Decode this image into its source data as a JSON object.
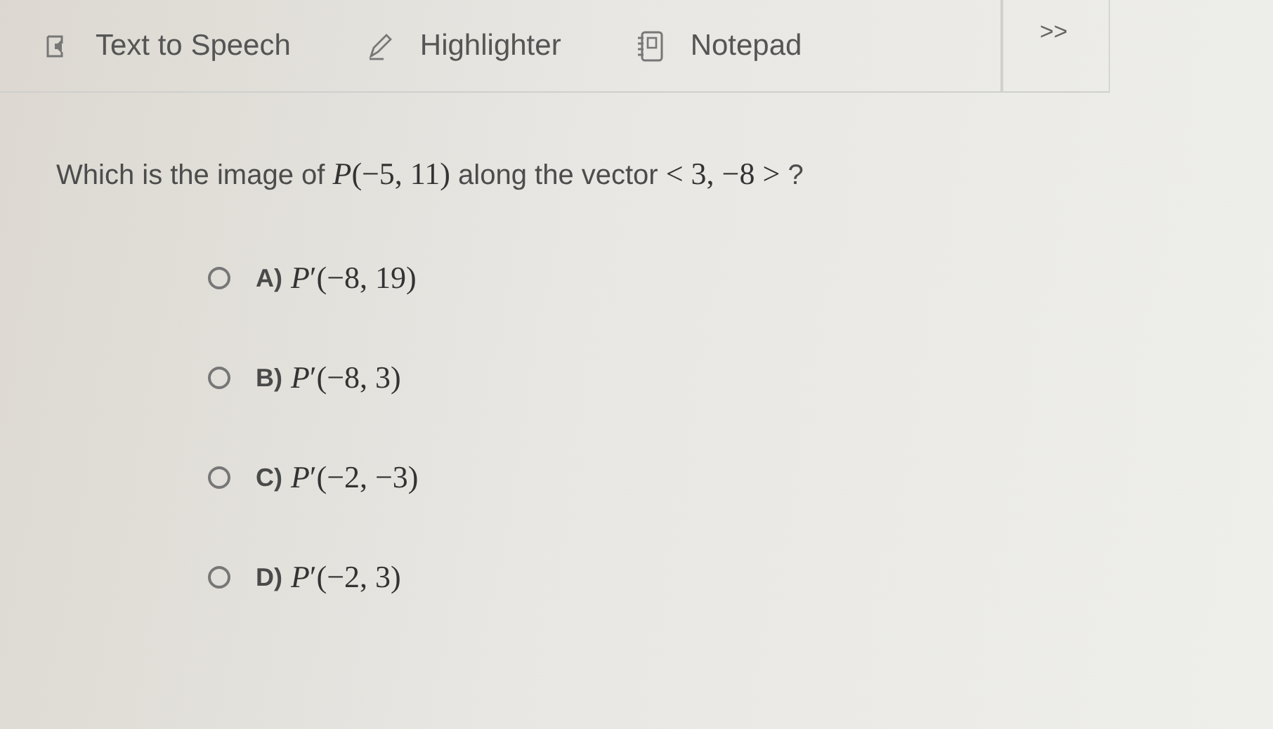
{
  "toolbar": {
    "tools": [
      {
        "kind": "speech",
        "label": "Text to Speech"
      },
      {
        "kind": "highlighter",
        "label": "Highlighter"
      },
      {
        "kind": "notepad",
        "label": "Notepad"
      }
    ],
    "more": ">>"
  },
  "question": [
    {
      "kind": "text",
      "text": "Which is the image of"
    },
    {
      "kind": "math",
      "text": "*P*(−5, 11)"
    },
    {
      "kind": "text",
      "text": "along the vector"
    },
    {
      "kind": "math",
      "text": "< 3, −8 >"
    },
    {
      "kind": "text",
      "text": "?"
    }
  ],
  "options": [
    {
      "letter": "A)",
      "answer": "*P*′(−8, 19)",
      "selected": false
    },
    {
      "letter": "B)",
      "answer": "*P*′(−8, 3)",
      "selected": false
    },
    {
      "letter": "C)",
      "answer": "*P*′(−2, −3)",
      "selected": false
    },
    {
      "letter": "D)",
      "answer": "*P*′(−2, 3)",
      "selected": false
    }
  ]
}
